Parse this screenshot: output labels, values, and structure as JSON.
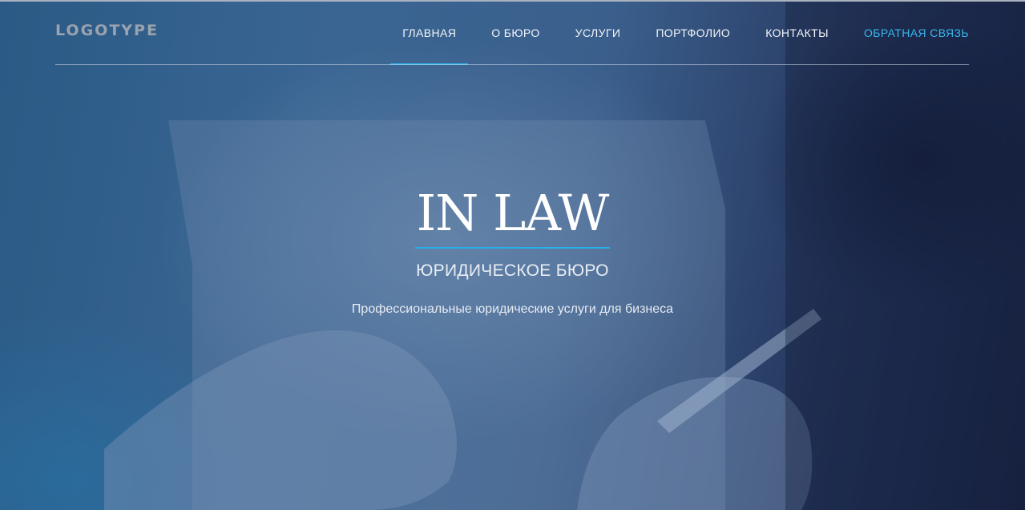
{
  "header": {
    "logo": "LOGOTYPE",
    "nav": [
      {
        "label": "ГЛАВНАЯ"
      },
      {
        "label": "О БЮРО"
      },
      {
        "label": "УСЛУГИ"
      },
      {
        "label": "ПОРТФОЛИО"
      },
      {
        "label": "КОНТАКТЫ"
      },
      {
        "label": "ОБРАТНАЯ СВЯЗЬ"
      }
    ],
    "active_index": 0
  },
  "hero": {
    "title": "IN LAW",
    "subtitle": "ЮРИДИЧЕСКОЕ БЮРО",
    "tagline": "Профессиональные юридические услуги для бизнеса"
  },
  "colors": {
    "accent": "#29b0ea",
    "feedback_link": "#38b6ee",
    "logo": "#9aa3ae",
    "nav_text": "#f2f5f9",
    "background_dark": "#1c2b4a"
  }
}
